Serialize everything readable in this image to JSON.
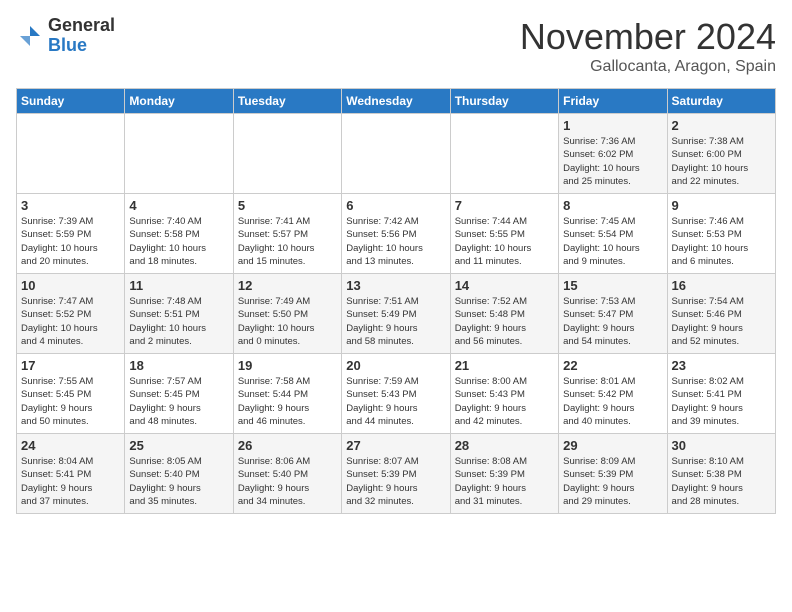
{
  "header": {
    "logo": {
      "general": "General",
      "blue": "Blue"
    },
    "title": "November 2024",
    "subtitle": "Gallocanta, Aragon, Spain"
  },
  "weekdays": [
    "Sunday",
    "Monday",
    "Tuesday",
    "Wednesday",
    "Thursday",
    "Friday",
    "Saturday"
  ],
  "weeks": [
    [
      {
        "day": "",
        "info": ""
      },
      {
        "day": "",
        "info": ""
      },
      {
        "day": "",
        "info": ""
      },
      {
        "day": "",
        "info": ""
      },
      {
        "day": "",
        "info": ""
      },
      {
        "day": "1",
        "info": "Sunrise: 7:36 AM\nSunset: 6:02 PM\nDaylight: 10 hours\nand 25 minutes."
      },
      {
        "day": "2",
        "info": "Sunrise: 7:38 AM\nSunset: 6:00 PM\nDaylight: 10 hours\nand 22 minutes."
      }
    ],
    [
      {
        "day": "3",
        "info": "Sunrise: 7:39 AM\nSunset: 5:59 PM\nDaylight: 10 hours\nand 20 minutes."
      },
      {
        "day": "4",
        "info": "Sunrise: 7:40 AM\nSunset: 5:58 PM\nDaylight: 10 hours\nand 18 minutes."
      },
      {
        "day": "5",
        "info": "Sunrise: 7:41 AM\nSunset: 5:57 PM\nDaylight: 10 hours\nand 15 minutes."
      },
      {
        "day": "6",
        "info": "Sunrise: 7:42 AM\nSunset: 5:56 PM\nDaylight: 10 hours\nand 13 minutes."
      },
      {
        "day": "7",
        "info": "Sunrise: 7:44 AM\nSunset: 5:55 PM\nDaylight: 10 hours\nand 11 minutes."
      },
      {
        "day": "8",
        "info": "Sunrise: 7:45 AM\nSunset: 5:54 PM\nDaylight: 10 hours\nand 9 minutes."
      },
      {
        "day": "9",
        "info": "Sunrise: 7:46 AM\nSunset: 5:53 PM\nDaylight: 10 hours\nand 6 minutes."
      }
    ],
    [
      {
        "day": "10",
        "info": "Sunrise: 7:47 AM\nSunset: 5:52 PM\nDaylight: 10 hours\nand 4 minutes."
      },
      {
        "day": "11",
        "info": "Sunrise: 7:48 AM\nSunset: 5:51 PM\nDaylight: 10 hours\nand 2 minutes."
      },
      {
        "day": "12",
        "info": "Sunrise: 7:49 AM\nSunset: 5:50 PM\nDaylight: 10 hours\nand 0 minutes."
      },
      {
        "day": "13",
        "info": "Sunrise: 7:51 AM\nSunset: 5:49 PM\nDaylight: 9 hours\nand 58 minutes."
      },
      {
        "day": "14",
        "info": "Sunrise: 7:52 AM\nSunset: 5:48 PM\nDaylight: 9 hours\nand 56 minutes."
      },
      {
        "day": "15",
        "info": "Sunrise: 7:53 AM\nSunset: 5:47 PM\nDaylight: 9 hours\nand 54 minutes."
      },
      {
        "day": "16",
        "info": "Sunrise: 7:54 AM\nSunset: 5:46 PM\nDaylight: 9 hours\nand 52 minutes."
      }
    ],
    [
      {
        "day": "17",
        "info": "Sunrise: 7:55 AM\nSunset: 5:45 PM\nDaylight: 9 hours\nand 50 minutes."
      },
      {
        "day": "18",
        "info": "Sunrise: 7:57 AM\nSunset: 5:45 PM\nDaylight: 9 hours\nand 48 minutes."
      },
      {
        "day": "19",
        "info": "Sunrise: 7:58 AM\nSunset: 5:44 PM\nDaylight: 9 hours\nand 46 minutes."
      },
      {
        "day": "20",
        "info": "Sunrise: 7:59 AM\nSunset: 5:43 PM\nDaylight: 9 hours\nand 44 minutes."
      },
      {
        "day": "21",
        "info": "Sunrise: 8:00 AM\nSunset: 5:43 PM\nDaylight: 9 hours\nand 42 minutes."
      },
      {
        "day": "22",
        "info": "Sunrise: 8:01 AM\nSunset: 5:42 PM\nDaylight: 9 hours\nand 40 minutes."
      },
      {
        "day": "23",
        "info": "Sunrise: 8:02 AM\nSunset: 5:41 PM\nDaylight: 9 hours\nand 39 minutes."
      }
    ],
    [
      {
        "day": "24",
        "info": "Sunrise: 8:04 AM\nSunset: 5:41 PM\nDaylight: 9 hours\nand 37 minutes."
      },
      {
        "day": "25",
        "info": "Sunrise: 8:05 AM\nSunset: 5:40 PM\nDaylight: 9 hours\nand 35 minutes."
      },
      {
        "day": "26",
        "info": "Sunrise: 8:06 AM\nSunset: 5:40 PM\nDaylight: 9 hours\nand 34 minutes."
      },
      {
        "day": "27",
        "info": "Sunrise: 8:07 AM\nSunset: 5:39 PM\nDaylight: 9 hours\nand 32 minutes."
      },
      {
        "day": "28",
        "info": "Sunrise: 8:08 AM\nSunset: 5:39 PM\nDaylight: 9 hours\nand 31 minutes."
      },
      {
        "day": "29",
        "info": "Sunrise: 8:09 AM\nSunset: 5:39 PM\nDaylight: 9 hours\nand 29 minutes."
      },
      {
        "day": "30",
        "info": "Sunrise: 8:10 AM\nSunset: 5:38 PM\nDaylight: 9 hours\nand 28 minutes."
      }
    ]
  ]
}
